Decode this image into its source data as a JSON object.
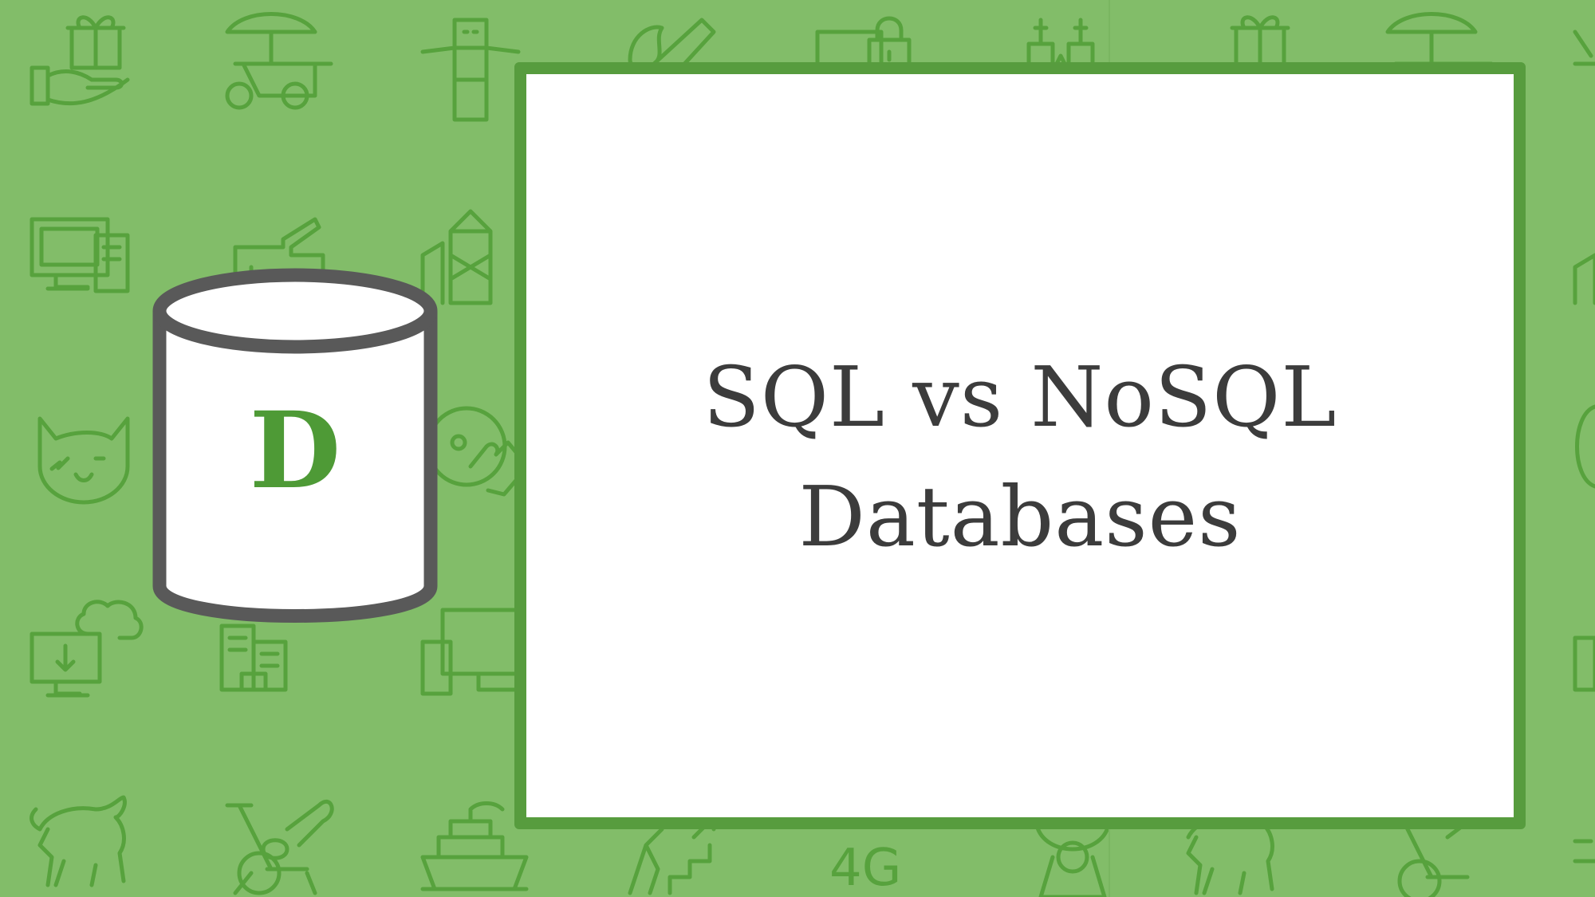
{
  "title": {
    "line1": "SQL vs NoSQL",
    "line2": "Databases"
  },
  "database_icon": {
    "letter": "D"
  },
  "colors": {
    "background": "#82bd69",
    "pattern": "#57a23d",
    "frame": "#579c3e",
    "text": "#3c3c3c",
    "letter": "#4e9a36"
  },
  "pattern_texts": {
    "network_label": "4G"
  }
}
